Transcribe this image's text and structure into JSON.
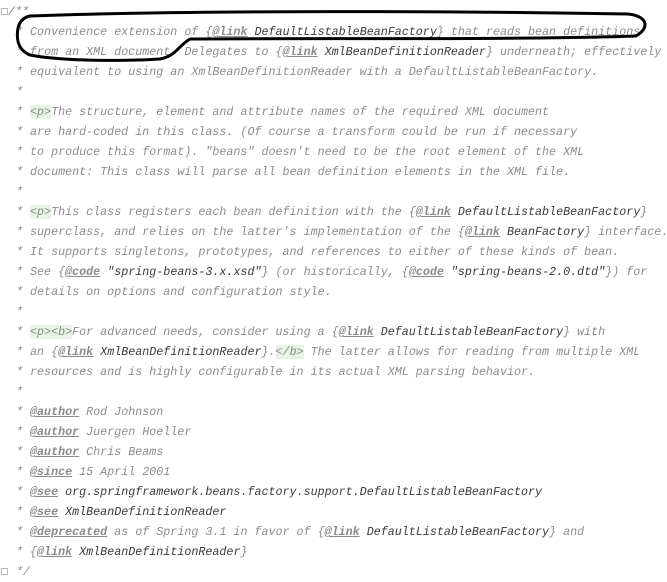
{
  "colors": {
    "comment": "#8c8c8c",
    "reference": "#3a3a3a",
    "html_tag_bg": "#e6f4e6",
    "annotation": "#000000"
  },
  "lines": [
    [
      [
        "plain",
        "/**"
      ]
    ],
    [
      [
        "plain",
        "* Convenience extension of {"
      ],
      [
        "tag",
        "@link"
      ],
      [
        "plain",
        " "
      ],
      [
        "ref",
        "DefaultListableBeanFactory"
      ],
      [
        "plain",
        "} that reads bean definitions"
      ]
    ],
    [
      [
        "plain",
        "* from an XML document. Delegates to {"
      ],
      [
        "tag",
        "@link"
      ],
      [
        "plain",
        " "
      ],
      [
        "ref",
        "XmlBeanDefinitionReader"
      ],
      [
        "plain",
        "} underneath; effectively"
      ]
    ],
    [
      [
        "plain",
        "* equivalent to using an XmlBeanDefinitionReader with a DefaultListableBeanFactory."
      ]
    ],
    [
      [
        "plain",
        "*"
      ]
    ],
    [
      [
        "plain",
        "* "
      ],
      [
        "html",
        "<p>"
      ],
      [
        "plain",
        "The structure, element and attribute names of the required XML document"
      ]
    ],
    [
      [
        "plain",
        "* are hard-coded in this class. (Of course a transform could be run if necessary"
      ]
    ],
    [
      [
        "plain",
        "* to produce this format). \"beans\" doesn't need to be the root element of the XML"
      ]
    ],
    [
      [
        "plain",
        "* document: This class will parse all bean definition elements in the XML file."
      ]
    ],
    [
      [
        "plain",
        "*"
      ]
    ],
    [
      [
        "plain",
        "* "
      ],
      [
        "html",
        "<p>"
      ],
      [
        "plain",
        "This class registers each bean definition with the {"
      ],
      [
        "tag",
        "@link"
      ],
      [
        "plain",
        " "
      ],
      [
        "ref",
        "DefaultListableBeanFactory"
      ],
      [
        "plain",
        "}"
      ]
    ],
    [
      [
        "plain",
        "* superclass, and relies on the latter's implementation of the {"
      ],
      [
        "tag",
        "@link"
      ],
      [
        "plain",
        " "
      ],
      [
        "ref",
        "BeanFactory"
      ],
      [
        "plain",
        "} interface."
      ]
    ],
    [
      [
        "plain",
        "* It supports singletons, prototypes, and references to either of these kinds of bean."
      ]
    ],
    [
      [
        "plain",
        "* See {"
      ],
      [
        "tag",
        "@code"
      ],
      [
        "plain",
        " "
      ],
      [
        "ref",
        "\"spring-beans-3.x.xsd\""
      ],
      [
        "plain",
        "} (or historically, {"
      ],
      [
        "tag",
        "@code"
      ],
      [
        "plain",
        " "
      ],
      [
        "ref",
        "\"spring-beans-2.0.dtd\""
      ],
      [
        "plain",
        "}) for"
      ]
    ],
    [
      [
        "plain",
        "* details on options and configuration style."
      ]
    ],
    [
      [
        "plain",
        "*"
      ]
    ],
    [
      [
        "plain",
        "* "
      ],
      [
        "html",
        "<p><b>"
      ],
      [
        "plain",
        "For advanced needs, consider using a {"
      ],
      [
        "tag",
        "@link"
      ],
      [
        "plain",
        " "
      ],
      [
        "ref",
        "DefaultListableBeanFactory"
      ],
      [
        "plain",
        "} with"
      ]
    ],
    [
      [
        "plain",
        "* an {"
      ],
      [
        "tag",
        "@link"
      ],
      [
        "plain",
        " "
      ],
      [
        "ref",
        "XmlBeanDefinitionReader"
      ],
      [
        "plain",
        "}."
      ],
      [
        "html",
        "</b>"
      ],
      [
        "plain",
        " The latter allows for reading from multiple XML"
      ]
    ],
    [
      [
        "plain",
        "* resources and is highly configurable in its actual XML parsing behavior."
      ]
    ],
    [
      [
        "plain",
        "*"
      ]
    ],
    [
      [
        "plain",
        "* "
      ],
      [
        "tag",
        "@author"
      ],
      [
        "plain",
        " Rod Johnson"
      ]
    ],
    [
      [
        "plain",
        "* "
      ],
      [
        "tag",
        "@author"
      ],
      [
        "plain",
        " Juergen Hoeller"
      ]
    ],
    [
      [
        "plain",
        "* "
      ],
      [
        "tag",
        "@author"
      ],
      [
        "plain",
        " Chris Beams"
      ]
    ],
    [
      [
        "plain",
        "* "
      ],
      [
        "tag",
        "@since"
      ],
      [
        "plain",
        " 15 April 2001"
      ]
    ],
    [
      [
        "plain",
        "* "
      ],
      [
        "tag",
        "@see"
      ],
      [
        "plain",
        " "
      ],
      [
        "ref",
        "org.springframework.beans.factory.support.DefaultListableBeanFactory"
      ]
    ],
    [
      [
        "plain",
        "* "
      ],
      [
        "tag",
        "@see"
      ],
      [
        "plain",
        " "
      ],
      [
        "ref",
        "XmlBeanDefinitionReader"
      ]
    ],
    [
      [
        "plain",
        "* "
      ],
      [
        "tag",
        "@deprecated"
      ],
      [
        "plain",
        " as of Spring 3.1 in favor of {"
      ],
      [
        "tag",
        "@link"
      ],
      [
        "plain",
        " "
      ],
      [
        "ref",
        "DefaultListableBeanFactory"
      ],
      [
        "plain",
        "} and"
      ]
    ],
    [
      [
        "plain",
        "* {"
      ],
      [
        "tag",
        "@link"
      ],
      [
        "plain",
        " "
      ],
      [
        "ref",
        "XmlBeanDefinitionReader"
      ],
      [
        "plain",
        "}"
      ]
    ],
    [
      [
        "plain",
        "*/"
      ]
    ]
  ]
}
